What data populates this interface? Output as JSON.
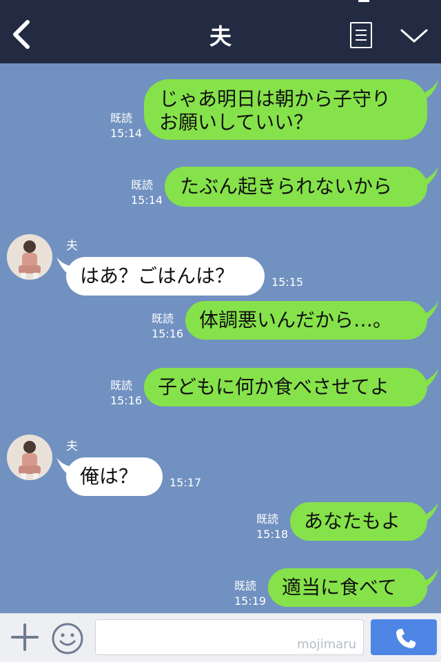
{
  "header": {
    "title": "夫"
  },
  "messages": [
    {
      "read": "既読",
      "time": "15:14",
      "line1": "じゃあ明日は朝から子守り",
      "line2": "お願いしていい？"
    },
    {
      "read": "既読",
      "time": "15:14",
      "text": "たぶん起きられないから"
    },
    {
      "sender": "夫",
      "time": "15:15",
      "text": "はあ？ごはんは？"
    },
    {
      "read": "既読",
      "time": "15:16",
      "text": "体調悪いんだから…。"
    },
    {
      "read": "既読",
      "time": "15:16",
      "text": "子どもに何か食べさせてよ"
    },
    {
      "sender": "夫",
      "time": "15:17",
      "text": "俺は？"
    },
    {
      "read": "既読",
      "time": "15:18",
      "text": "あなたもよ"
    },
    {
      "read": "既読",
      "time": "15:19",
      "text": "適当に食べて"
    }
  ],
  "footer": {
    "watermark": "mojimaru"
  }
}
